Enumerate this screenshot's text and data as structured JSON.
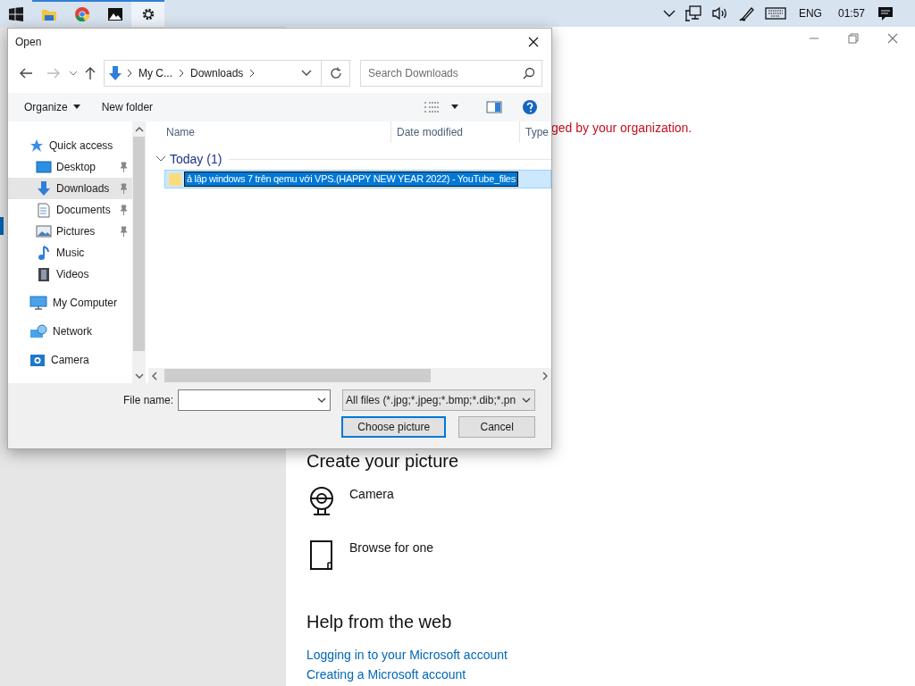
{
  "taskbar": {
    "apps": [
      {
        "kind": "start",
        "running": false,
        "selected": false
      },
      {
        "kind": "folder",
        "running": true,
        "selected": false
      },
      {
        "kind": "browser",
        "running": true,
        "selected": false
      },
      {
        "kind": "photos",
        "running": true,
        "selected": false
      },
      {
        "kind": "settings",
        "running": true,
        "selected": true
      }
    ],
    "tray": [
      {
        "kind": "chevron"
      },
      {
        "kind": "network"
      },
      {
        "kind": "volume"
      },
      {
        "kind": "pen"
      },
      {
        "kind": "keyboard"
      },
      {
        "kind": "text",
        "label": "ENG"
      },
      {
        "kind": "text",
        "label": "01:57"
      },
      {
        "kind": "notification"
      }
    ]
  },
  "settings_window": {
    "notice": "ged by your organization.",
    "create_heading": "Create your picture",
    "options": [
      {
        "kind": "camera",
        "label": "Camera"
      },
      {
        "kind": "browse",
        "label": "Browse for one"
      }
    ],
    "help_heading": "Help from the web",
    "links": [
      "Logging in to your Microsoft account",
      "Creating a Microsoft account"
    ]
  },
  "dialog": {
    "title": "Open",
    "address": [
      "My C...",
      "Downloads"
    ],
    "search": {
      "placeholder": "Search Downloads"
    },
    "toolbar": [
      "Organize",
      "New folder"
    ],
    "nav_pane": [
      {
        "kind": "star",
        "label": "Quick access",
        "children": [
          {
            "kind": "desktop",
            "label": "Desktop",
            "pinned": true,
            "selected": false
          },
          {
            "kind": "download",
            "label": "Downloads",
            "pinned": true,
            "selected": true
          },
          {
            "kind": "document",
            "label": "Documents",
            "pinned": true,
            "selected": false
          },
          {
            "kind": "picture",
            "label": "Pictures",
            "pinned": true,
            "selected": false
          },
          {
            "kind": "music",
            "label": "Music",
            "pinned": false,
            "selected": false
          },
          {
            "kind": "video",
            "label": "Videos",
            "pinned": false,
            "selected": false
          }
        ],
        "selected": false
      },
      {
        "kind": "computer",
        "label": "My Computer",
        "selected": false
      },
      {
        "kind": "network",
        "label": "Network",
        "selected": false
      },
      {
        "kind": "camera",
        "label": "Camera",
        "selected": false
      }
    ],
    "columns": [
      "Name",
      "Date modified",
      "Type"
    ],
    "groups": [
      {
        "label": "Today (1)",
        "expanded": true,
        "items": [
          {
            "name": "ả lập windows 7 trên qemu với VPS.(HAPPY NEW YEAR 2022) - YouTube_files",
            "selected": true
          }
        ]
      }
    ],
    "file_name_label": "File name:",
    "filter": "All files (*.jpg;*.jpeg;*.bmp;*.dib;*.pn",
    "buttons": [
      {
        "label": "Choose picture",
        "default": true
      },
      {
        "label": "Cancel",
        "default": false
      }
    ]
  }
}
